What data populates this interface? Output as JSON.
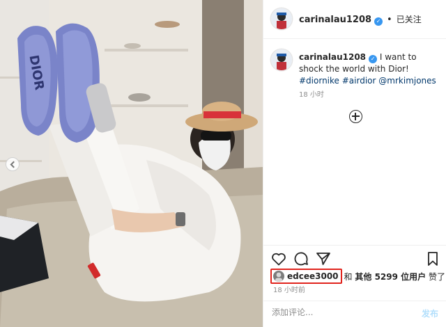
{
  "photo": {
    "shoe_text": "DIOR",
    "alt_description_icon": "image"
  },
  "header": {
    "username": "carinalau1208",
    "verified_icon": "verified-badge-icon",
    "separator": "•",
    "follow_status": "已关注"
  },
  "caption": {
    "username": "carinalau1208",
    "text": "I want to shock the world with Dior!",
    "hashtags": [
      "#diornike",
      "#airdior"
    ],
    "mention": "@mrkimjones",
    "time": "18 小时"
  },
  "actions": {
    "icons": [
      "heart-icon",
      "comment-icon",
      "share-icon",
      "bookmark-icon"
    ]
  },
  "likes": {
    "liker": "edcee3000",
    "connector": "和",
    "others_prefix": "其他",
    "count": "5299",
    "others_suffix": "位用户",
    "liked": "赞了",
    "highlight_color": "#e0231c"
  },
  "time_ago": "18 小时前",
  "comment": {
    "placeholder": "添加评论...",
    "post_label": "发布"
  },
  "colors": {
    "verified": "#3897f0",
    "link": "#00376b",
    "muted": "#8e8e8e",
    "post_disabled": "#b2dffc"
  }
}
